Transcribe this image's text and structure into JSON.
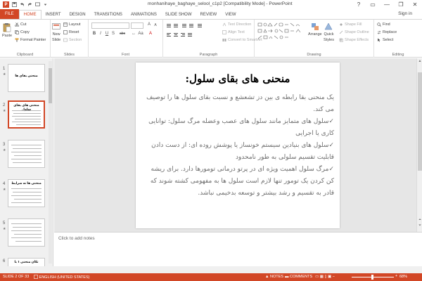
{
  "window": {
    "title": "monhanihaye_baghaye_selool_c1p2 [Compatibility Mode] - PowerPoint",
    "sign_in": "Sign in",
    "help": "?",
    "minimize": "—",
    "restore": "❐",
    "close": "✕"
  },
  "tabs": [
    "FILE",
    "HOME",
    "INSERT",
    "DESIGN",
    "TRANSITIONS",
    "ANIMATIONS",
    "SLIDE SHOW",
    "REVIEW",
    "VIEW"
  ],
  "active_tab": "HOME",
  "ribbon": {
    "clipboard": {
      "label": "Clipboard",
      "paste": "Paste",
      "cut": "Cut",
      "copy": "Copy",
      "format_painter": "Format Painter"
    },
    "slides": {
      "label": "Slides",
      "new_slide": "New",
      "new_slide2": "Slide",
      "layout": "Layout",
      "reset": "Reset",
      "section": "Section"
    },
    "font": {
      "label": "Font",
      "bold": "B",
      "italic": "I",
      "underline": "U",
      "strike": "S",
      "shadow": "abc"
    },
    "paragraph": {
      "label": "Paragraph",
      "text_direction": "Text Direction",
      "align_text": "Align Text",
      "convert_smartart": "Convert to SmartArt"
    },
    "drawing": {
      "label": "Drawing",
      "arrange": "Arrange",
      "quick_styles": "Quick",
      "quick_styles2": "Styles",
      "shape_fill": "Shape Fill",
      "shape_outline": "Shape Outline",
      "shape_effects": "Shape Effects"
    },
    "editing": {
      "label": "Editing",
      "find": "Find",
      "replace": "Replace",
      "select": "Select"
    }
  },
  "thumbnails": [
    {
      "num": "1",
      "title": "منحنی بقای ها"
    },
    {
      "num": "2",
      "title": "منحنی های بقای سلول"
    },
    {
      "num": "3",
      "title": ""
    },
    {
      "num": "4",
      "title": "منحنی ها نه شرایط"
    },
    {
      "num": "5",
      "title": ""
    },
    {
      "num": "6",
      "title": "تکان منحنی ۱ با"
    }
  ],
  "slide": {
    "title": "منحنی های بقای سلول:",
    "paragraphs": [
      "یک منحنی بقا رابطه ی بین دز تشعشع و نسبت بقای سلول ها را توصیف می کند.",
      "✓سلول های متمایز مانند سلول های عصب وعضله مرگ سلول: توانایی کاری یا اجرایی",
      "✓سلول های بنیادین سیستم خونساز یا پوشش روده ای: از دست دادن قابلیت تقسیم سلولی به طور نامحدود",
      "✓مرگ سلول اهمیت ویژه ای در پرتو درمانی تومورها دارد. برای ریشه کن کردن یک تومور تنها لازم است سلول ها به مفهومی کشته شوند که قادر به تقسیم و رشد بیشتر و توسعه بدخیمی نباشد."
    ]
  },
  "notes": {
    "placeholder": "Click to add notes"
  },
  "status": {
    "slide_count": "SLIDE 2 OF 33",
    "language": "ENGLISH (UNITED STATES)",
    "notes": "NOTES",
    "comments": "COMMENTS",
    "zoom": "68%",
    "zoom_fraction": 0.68
  },
  "colors": {
    "accent": "#d24726"
  }
}
